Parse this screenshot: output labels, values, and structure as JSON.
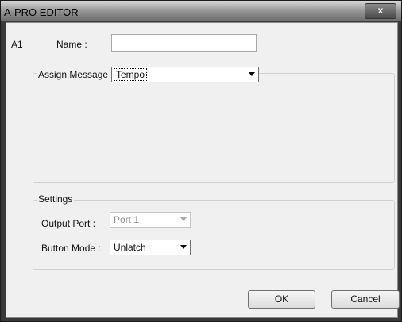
{
  "window": {
    "title": "A-PRO EDITOR",
    "close_glyph": "x"
  },
  "header": {
    "slot_id": "A1",
    "name_label": "Name :",
    "name_value": ""
  },
  "assign": {
    "label": "Assign Message :",
    "selected": "Tempo"
  },
  "settings": {
    "legend": "Settings",
    "output_port_label": "Output Port :",
    "output_port_value": "Port 1",
    "button_mode_label": "Button Mode :",
    "button_mode_value": "Unlatch"
  },
  "actions": {
    "ok_label": "OK",
    "cancel_label": "Cancel"
  }
}
